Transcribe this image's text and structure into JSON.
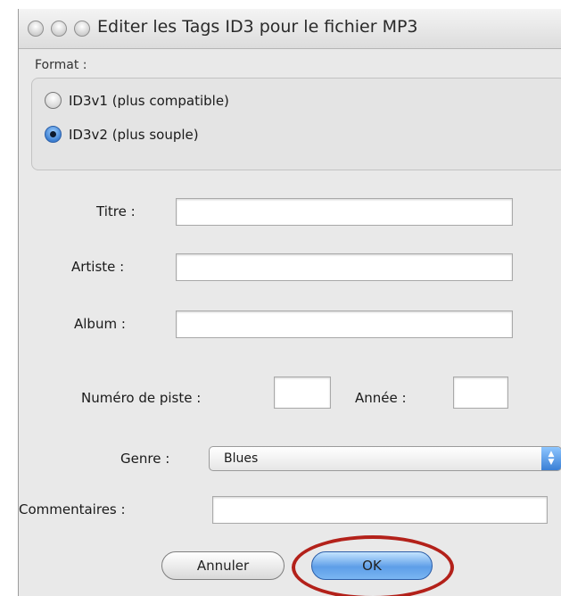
{
  "window": {
    "title": "Editer les Tags ID3 pour le fichier MP3"
  },
  "format": {
    "label": "Format :",
    "options": [
      {
        "label": "ID3v1 (plus compatible)",
        "selected": false
      },
      {
        "label": "ID3v2 (plus souple)",
        "selected": true
      }
    ]
  },
  "fields": {
    "titre": {
      "label": "Titre :",
      "value": ""
    },
    "artiste": {
      "label": "Artiste :",
      "value": ""
    },
    "album": {
      "label": "Album :",
      "value": ""
    },
    "numero_piste": {
      "label": "Numéro de piste :",
      "value": ""
    },
    "annee": {
      "label": "Année :",
      "value": ""
    },
    "genre": {
      "label": "Genre :",
      "value": "Blues"
    },
    "commentaires": {
      "label": "Commentaires :",
      "value": ""
    }
  },
  "buttons": {
    "cancel": "Annuler",
    "ok": "OK"
  },
  "colors": {
    "highlight_ring": "#b3211a",
    "default_button": "#5e9ee8"
  }
}
